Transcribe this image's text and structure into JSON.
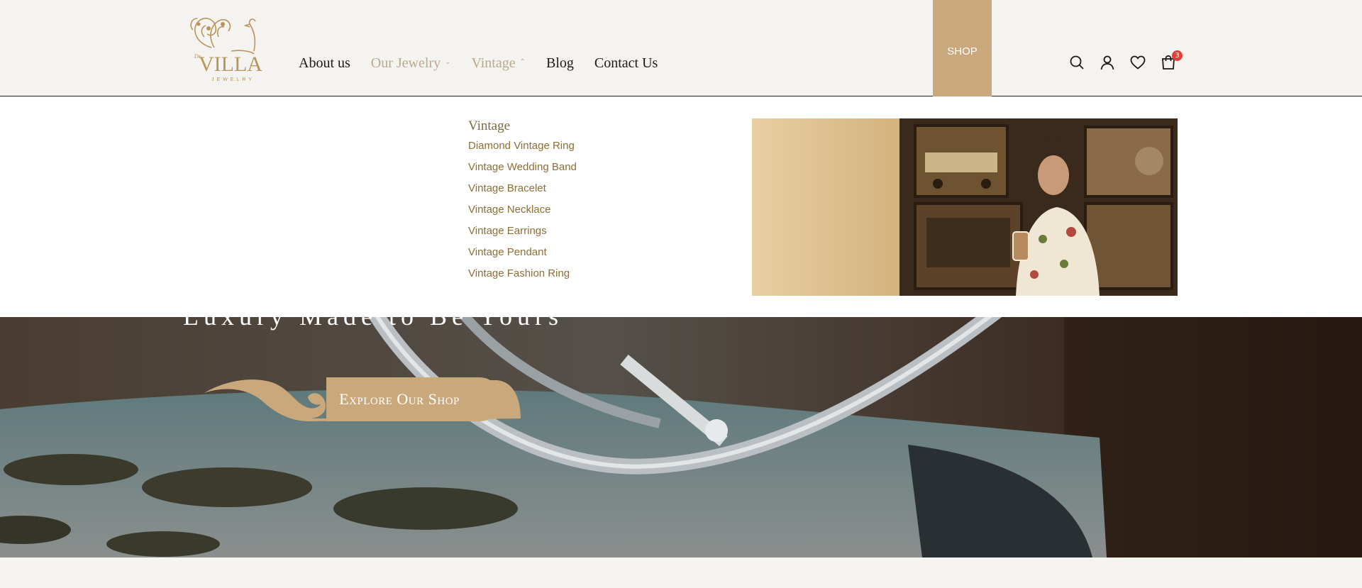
{
  "brand": {
    "logo_small": "De",
    "logo_main": "VILLA",
    "logo_sub": "JEWELRY"
  },
  "nav": {
    "items": [
      {
        "label": "About us",
        "has_dropdown": false,
        "muted": false
      },
      {
        "label": "Our Jewelry",
        "has_dropdown": true,
        "muted": true
      },
      {
        "label": "Vintage",
        "has_dropdown": true,
        "muted": true,
        "open": true
      },
      {
        "label": "Blog",
        "has_dropdown": false,
        "muted": false
      },
      {
        "label": "Contact Us",
        "has_dropdown": false,
        "muted": false
      }
    ],
    "shop_label": "SHOP"
  },
  "header_icons": {
    "search": "search-icon",
    "account": "user-icon",
    "wishlist": "heart-icon",
    "cart": "shopping-bag-icon",
    "cart_count": "3"
  },
  "mega_menu": {
    "title": "Vintage",
    "items": [
      "Diamond Vintage Ring",
      "Vintage Wedding Band",
      "Vintage Bracelet",
      "Vintage Necklace",
      "Vintage Earrings",
      "Vintage Pendant",
      "Vintage Fashion Ring"
    ]
  },
  "hero": {
    "tagline": "Luxury Made to Be Yours",
    "cta_label": "Explore Our Shop"
  },
  "colors": {
    "accent": "#c9a87c",
    "header_bg": "#f5f3ef",
    "menu_link": "#8d6e35",
    "cart_badge": "#e0413a"
  }
}
